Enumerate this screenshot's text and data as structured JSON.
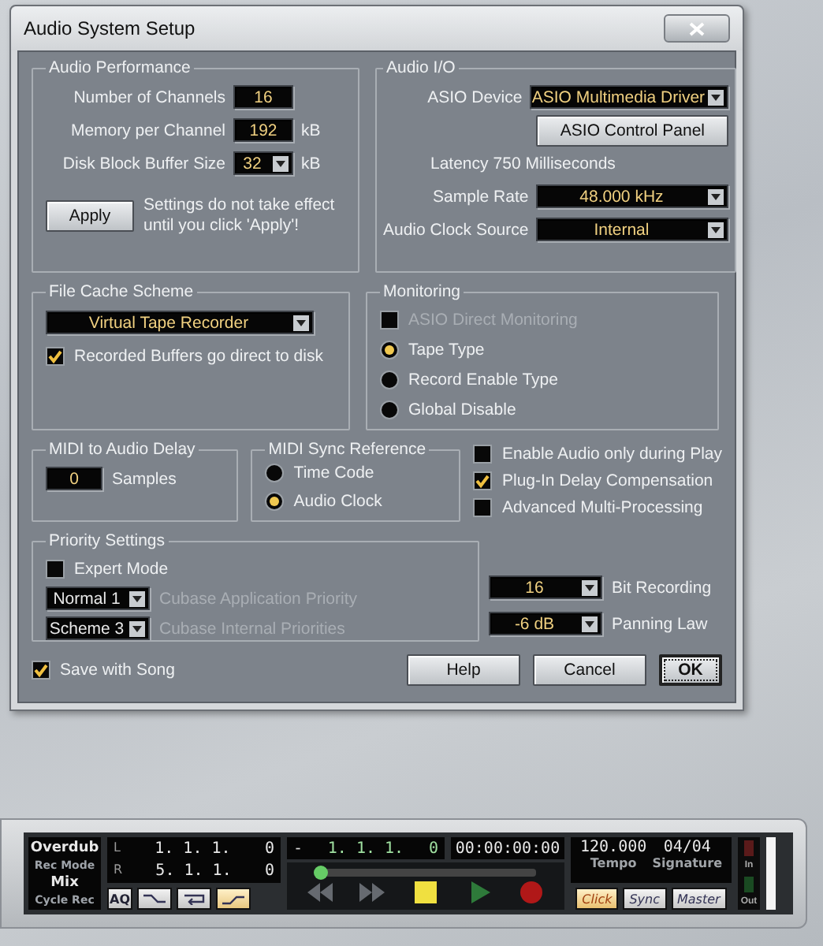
{
  "window": {
    "title": "Audio System Setup"
  },
  "audio_performance": {
    "title": "Audio Performance",
    "fields": [
      {
        "label": "Number of Channels",
        "value": "16",
        "kind": "field"
      },
      {
        "label": "Memory per Channel",
        "value": "192",
        "unit": "kB",
        "kind": "field"
      },
      {
        "label": "Disk Block Buffer Size",
        "value": "32",
        "unit": "kB",
        "kind": "dropdown"
      }
    ],
    "apply_button": "Apply",
    "apply_note": "Settings do not take effect until you click 'Apply'!"
  },
  "audio_io": {
    "title": "Audio I/O",
    "asio_device": {
      "label": "ASIO Device",
      "value": "ASIO Multimedia Driver"
    },
    "control_panel_button": "ASIO Control Panel",
    "latency": {
      "label": "Latency",
      "value": "750 Milliseconds"
    },
    "sample_rate": {
      "label": "Sample Rate",
      "value": "48.000 kHz"
    },
    "clock_source": {
      "label": "Audio Clock Source",
      "value": "Internal"
    }
  },
  "file_cache": {
    "title": "File Cache Scheme",
    "value": "Virtual Tape Recorder",
    "checkbox": {
      "label": "Recorded Buffers go direct to disk",
      "checked": true
    }
  },
  "monitoring": {
    "title": "Monitoring",
    "direct": {
      "label": "ASIO Direct Monitoring",
      "checked": false,
      "disabled": true
    },
    "options": [
      {
        "label": "Tape Type",
        "selected": true
      },
      {
        "label": "Record Enable Type",
        "selected": false
      },
      {
        "label": "Global Disable",
        "selected": false
      }
    ]
  },
  "midi_delay": {
    "title": "MIDI to Audio Delay",
    "value": "0",
    "unit": "Samples"
  },
  "midi_sync": {
    "title": "MIDI Sync Reference",
    "options": [
      {
        "label": "Time Code",
        "selected": false
      },
      {
        "label": "Audio Clock",
        "selected": true
      }
    ]
  },
  "options": [
    {
      "label": "Enable Audio only during Play",
      "checked": false
    },
    {
      "label": "Plug-In Delay Compensation",
      "checked": true
    },
    {
      "label": "Advanced Multi-Processing",
      "checked": false
    }
  ],
  "priority": {
    "title": "Priority Settings",
    "expert": {
      "label": "Expert Mode",
      "checked": false
    },
    "disabled": true,
    "rows": [
      {
        "value": "Normal 1",
        "label": "Cubase Application Priority"
      },
      {
        "value": "Scheme 3",
        "label": "Cubase Internal Priorities"
      }
    ]
  },
  "recording": [
    {
      "value": "16",
      "label": "Bit Recording"
    },
    {
      "value": "-6 dB",
      "label": "Panning Law"
    }
  ],
  "save_with_song": {
    "label": "Save with Song",
    "checked": true
  },
  "buttons": [
    {
      "label": "Help",
      "default": false
    },
    {
      "label": "Cancel",
      "default": false
    },
    {
      "label": "OK",
      "default": true
    }
  ],
  "transport": {
    "rec_mode": {
      "value": "Overdub",
      "label": "Rec Mode"
    },
    "cycle_rec": {
      "value": "Mix",
      "label": "Cycle Rec"
    },
    "locators": [
      {
        "name": "L",
        "bars": "1. 1. 1.",
        "ticks": "0"
      },
      {
        "name": "R",
        "bars": "5. 1. 1.",
        "ticks": "0"
      }
    ],
    "mode_buttons": [
      {
        "kind": "text",
        "label": "AQ",
        "on": false
      },
      {
        "kind": "punch-in",
        "on": false
      },
      {
        "kind": "cycle",
        "on": false
      },
      {
        "kind": "punch-out",
        "on": true
      }
    ],
    "position": {
      "sign": "-",
      "bars": "1. 1. 1.",
      "ticks": "0",
      "timecode": "00:00:00:00",
      "level": 0.02
    },
    "tempo": {
      "value": "120.000",
      "label": "Tempo"
    },
    "signature": {
      "value": "04/04",
      "label": "Signature"
    },
    "sync_buttons": [
      {
        "label": "Click",
        "on": true
      },
      {
        "label": "Sync",
        "on": false
      },
      {
        "label": "Master",
        "on": false
      }
    ],
    "meter": {
      "in_label": "In",
      "out_label": "Out"
    }
  }
}
